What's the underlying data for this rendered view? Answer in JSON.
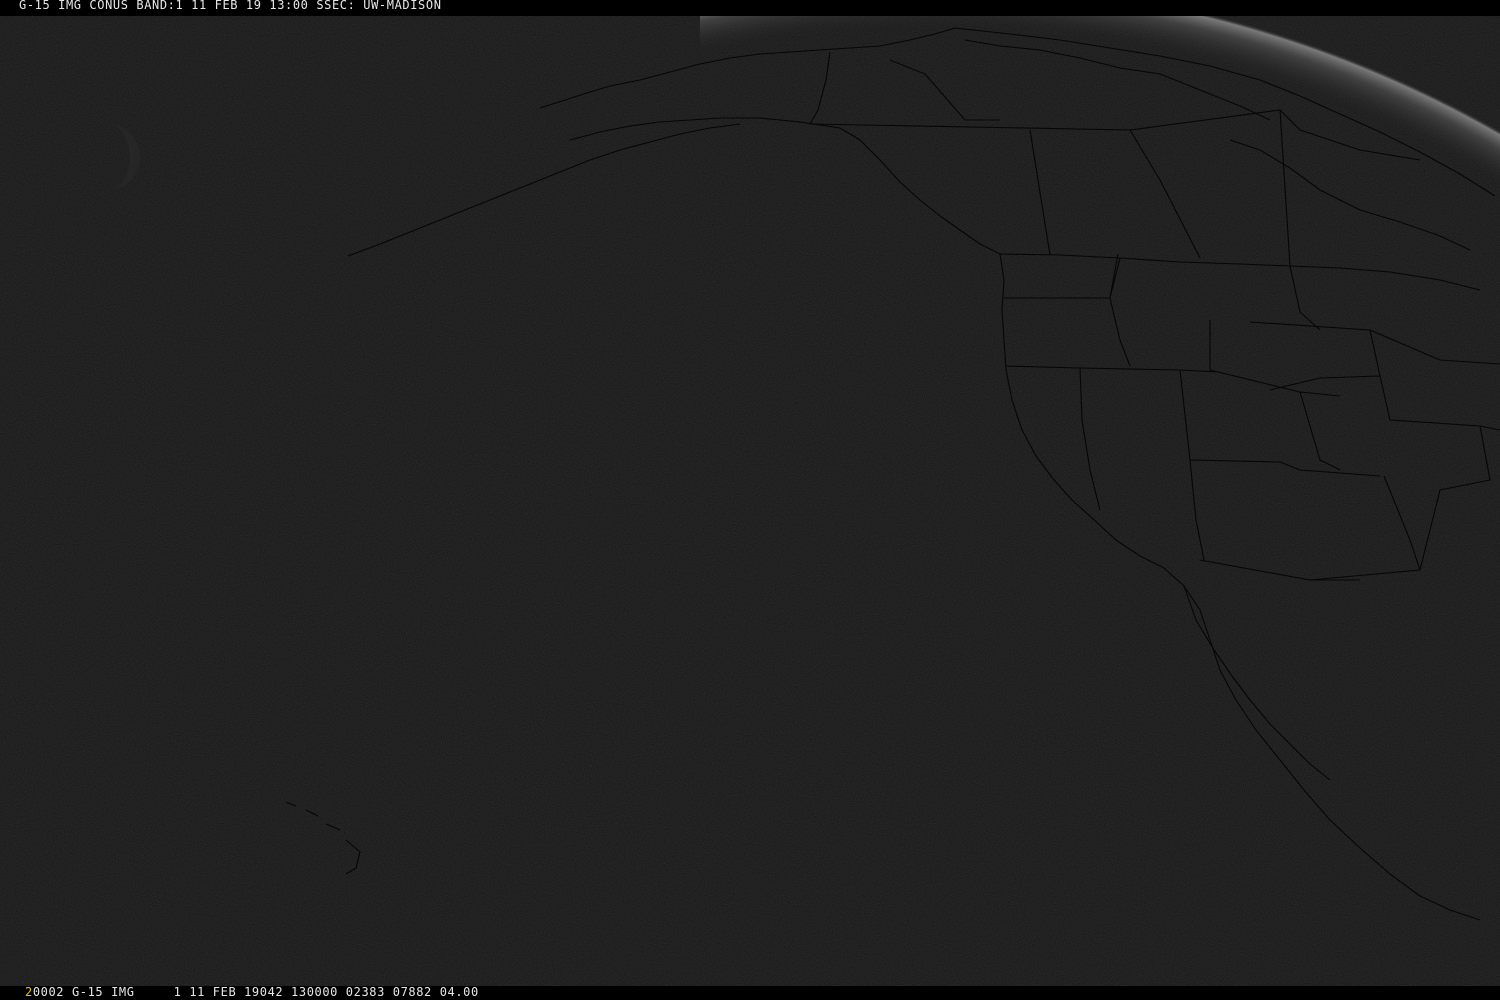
{
  "header": {
    "label": "G-15 IMG CONUS BAND:1 11 FEB 19 13:00 SSEC: UW-MADISON"
  },
  "footer": {
    "frame_number": "2",
    "label": "0002 G-15 IMG     1 11 FEB 19042 130000 02383 07882 04.00"
  },
  "colors": {
    "background": "#141414",
    "bars": "#000000",
    "text": "#e8e8e8",
    "frame_number": "#f0c000",
    "map_lines": "#060606",
    "limb_glow": "#9a9a9a"
  },
  "icons": {
    "moon": "moon-icon"
  }
}
